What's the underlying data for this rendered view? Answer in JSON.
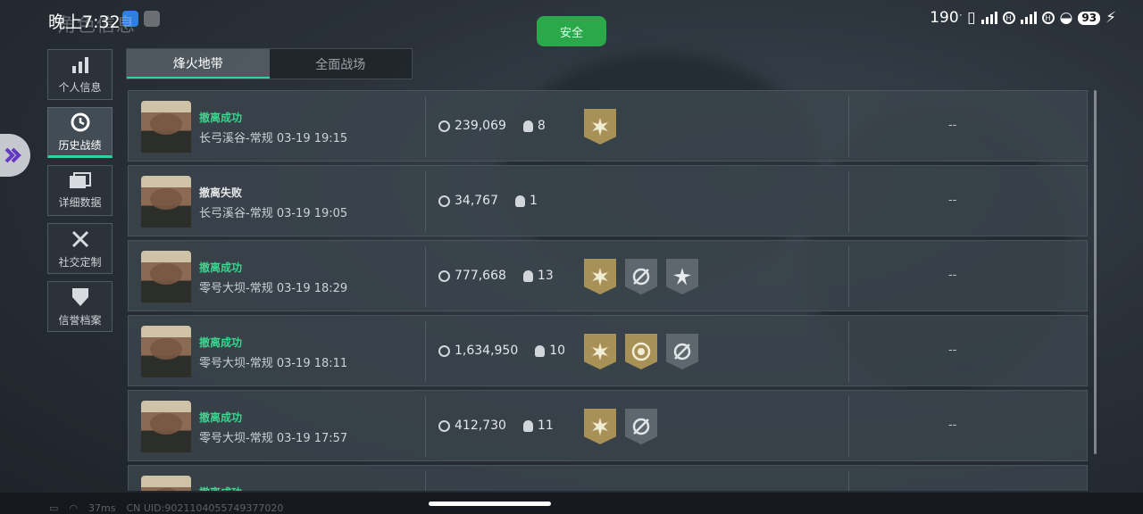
{
  "status_bar": {
    "time": "晚上7:32",
    "speed": "190",
    "battery": "93"
  },
  "safe_label": "安全",
  "page_title": "角色信息",
  "menu": [
    {
      "label": "个人信息",
      "icon": "bar-chart-icon",
      "active": false
    },
    {
      "label": "历史战绩",
      "icon": "history-clock-icon",
      "active": true
    },
    {
      "label": "详细数据",
      "icon": "folder-icon",
      "active": false
    },
    {
      "label": "社交定制",
      "icon": "tools-icon",
      "active": false
    },
    {
      "label": "信誉档案",
      "icon": "shield-icon",
      "active": false
    }
  ],
  "tabs": [
    {
      "label": "烽火地带",
      "active": true
    },
    {
      "label": "全面战场",
      "active": false
    }
  ],
  "records": [
    {
      "result": "撤离成功",
      "success": true,
      "map_time": "长弓溪谷-常规 03-19 19:15",
      "value": "239,069",
      "kills": "8",
      "badges": [
        "gold-sun"
      ],
      "extra": "--"
    },
    {
      "result": "撤离失败",
      "success": false,
      "map_time": "长弓溪谷-常规 03-19 19:05",
      "value": "34,767",
      "kills": "1",
      "badges": [],
      "extra": "--"
    },
    {
      "result": "撤离成功",
      "success": true,
      "map_time": "零号大坝-常规 03-19 18:29",
      "value": "777,668",
      "kills": "13",
      "badges": [
        "gold-sun",
        "silver-target",
        "silver-burst"
      ],
      "extra": "--"
    },
    {
      "result": "撤离成功",
      "success": true,
      "map_time": "零号大坝-常规 03-19 18:11",
      "value": "1,634,950",
      "kills": "10",
      "badges": [
        "gold-sun",
        "gold-emblem",
        "silver-target"
      ],
      "extra": "--"
    },
    {
      "result": "撤离成功",
      "success": true,
      "map_time": "零号大坝-常规 03-19 17:57",
      "value": "412,730",
      "kills": "11",
      "badges": [
        "gold-sun",
        "silver-target"
      ],
      "extra": "--"
    },
    {
      "result": "撤离成功",
      "success": true,
      "map_time": "",
      "value": "",
      "kills": "",
      "badges": [],
      "extra": ""
    }
  ],
  "footer": {
    "ping": "37ms",
    "uid": "CN UID:9021104055749377020"
  }
}
